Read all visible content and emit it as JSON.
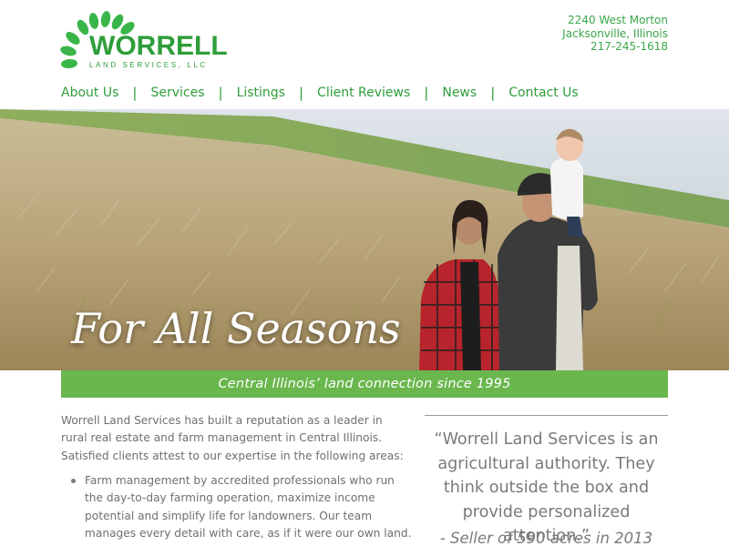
{
  "brand": {
    "name": "WORRELL",
    "subtitle": "LAND SERVICES, LLC",
    "color": "#2e9e3a",
    "leaf_color": "#3ab54a"
  },
  "contact": {
    "street": "2240 West Morton",
    "city": "Jacksonville, Illinois",
    "phone": "217-245-1618"
  },
  "nav": {
    "items": [
      {
        "label": "About Us"
      },
      {
        "label": "Services"
      },
      {
        "label": "Listings"
      },
      {
        "label": "Client Reviews"
      },
      {
        "label": "News"
      },
      {
        "label": "Contact Us"
      }
    ],
    "separator": "|"
  },
  "hero": {
    "title": "For All Seasons"
  },
  "tagline": {
    "text": "Central Illinois’ land connection since 1995",
    "bg_color": "#6ab74e"
  },
  "intro": {
    "text": "Worrell Land Services has built a reputation as a leader in rural real estate and farm management in Central Illinois. Satisfied clients attest to our expertise in the following areas:",
    "bullets": [
      "Farm management by accredited professionals who run the day-to-day farming operation, maximize income potential and simplify life for landowners. Our team manages every detail with care, as if it were our own land."
    ]
  },
  "testimonial": {
    "quote": "“Worrell Land Services is an agricultural authority. They think outside the box and provide personalized attention.”",
    "attribution": "- Seller of 590 acres in 2013"
  }
}
